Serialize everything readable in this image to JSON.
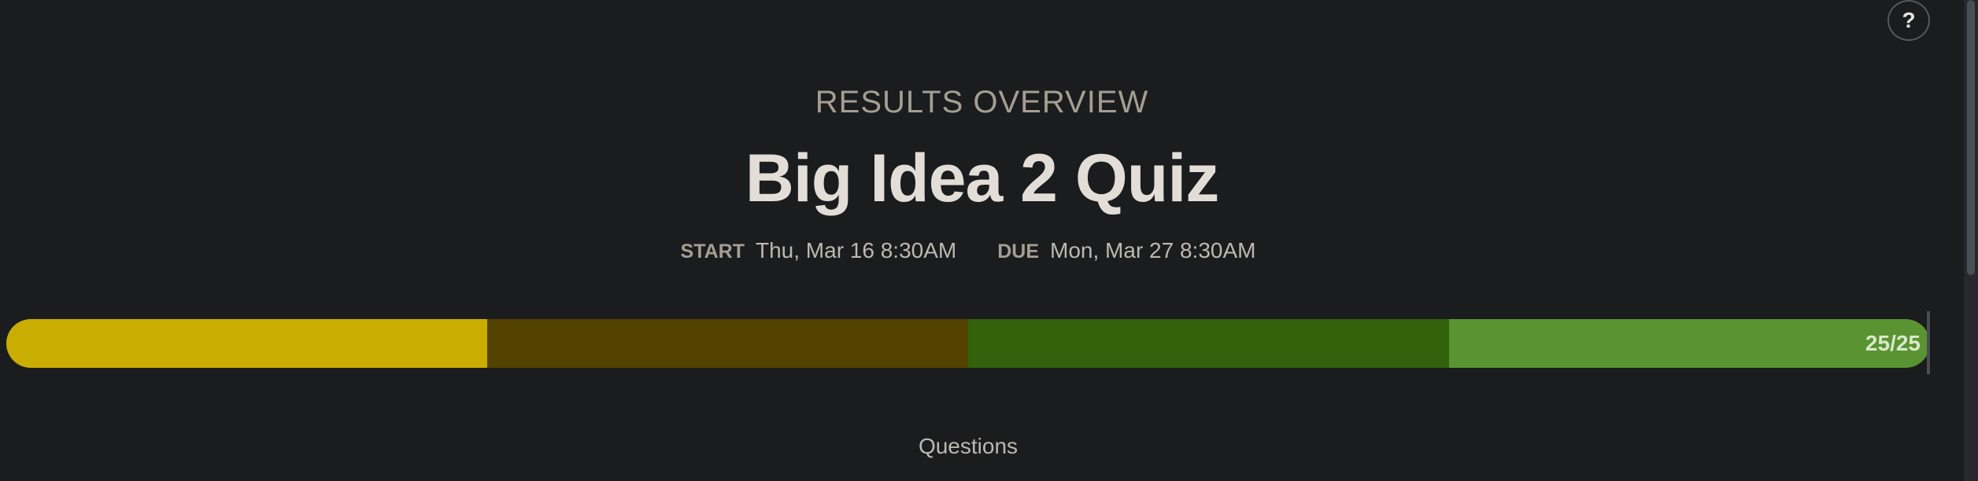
{
  "help": {
    "label": "?"
  },
  "header": {
    "eyebrow": "RESULTS OVERVIEW",
    "title": "Big Idea 2 Quiz"
  },
  "dates": {
    "start_label": "START",
    "start_value": "Thu, Mar 16 8:30AM",
    "due_label": "DUE",
    "due_value": "Mon, Mar 27 8:30AM"
  },
  "progress": {
    "label": "25/25",
    "completed": 25,
    "total": 25,
    "segments": [
      {
        "color": "#c9ad00"
      },
      {
        "color": "#534200"
      },
      {
        "color": "#32620b"
      },
      {
        "color": "#5a9332"
      }
    ]
  },
  "section": {
    "questions_label": "Questions"
  }
}
